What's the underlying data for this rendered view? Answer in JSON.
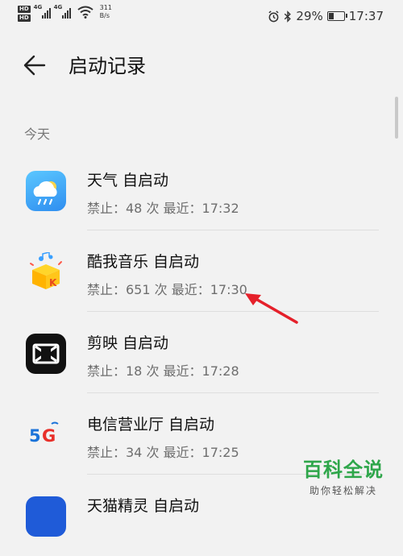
{
  "status_bar": {
    "net_speed_value": "311",
    "net_speed_unit": "B/s",
    "battery": "29%",
    "battery_level": 0.29,
    "time": "17:37",
    "icons": [
      "hd-icon",
      "signal-icon",
      "wifi-icon",
      "alarm-icon",
      "bluetooth-icon",
      "battery-icon"
    ]
  },
  "header": {
    "back_icon": "back-arrow-icon",
    "title": "启动记录"
  },
  "section": {
    "label": "今天"
  },
  "apps": [
    {
      "name": "天气 自启动",
      "meta": "禁止：48 次  最近：17:32",
      "icon": "weather-app-icon"
    },
    {
      "name": "酷我音乐 自启动",
      "meta": "禁止：651 次  最近：17:30",
      "icon": "kuwo-music-app-icon"
    },
    {
      "name": "剪映 自启动",
      "meta": "禁止：18 次  最近：17:28",
      "icon": "capcut-app-icon"
    },
    {
      "name": "电信营业厅 自启动",
      "meta": "禁止：34 次  最近：17:25",
      "icon": "telecom-5g-app-icon"
    },
    {
      "name": "天猫精灵 自启动",
      "meta": "",
      "icon": "tmall-genie-app-icon"
    }
  ],
  "watermark": {
    "main": "百科全说",
    "sub": "助你轻松解决"
  },
  "colors": {
    "background": "#f2f2f2",
    "annotation_arrow": "#e5202a",
    "watermark_green": "#2ea64a"
  }
}
